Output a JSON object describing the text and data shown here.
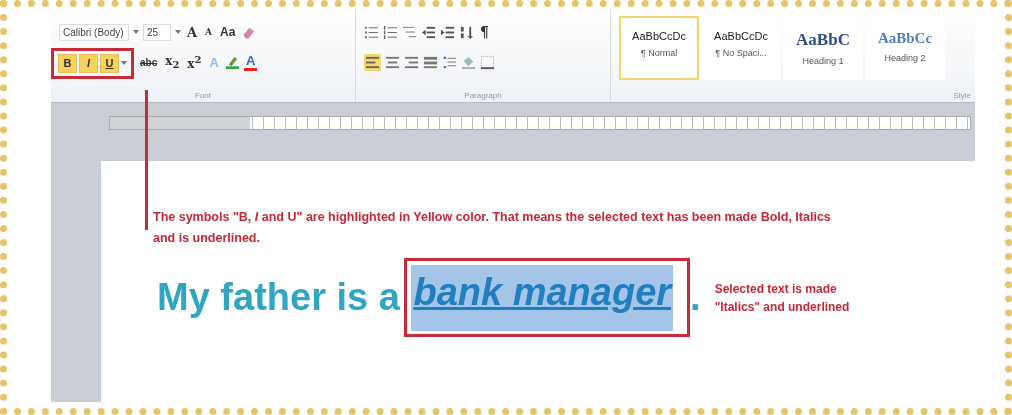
{
  "ribbon": {
    "font": {
      "font_name": "Calibri (Body)",
      "font_size": "25",
      "size_buttons": [
        "A",
        "A",
        "Aa"
      ],
      "format_buttons": [
        {
          "label": "B",
          "on": true
        },
        {
          "label": "I",
          "on": true
        },
        {
          "label": "U",
          "on": true
        }
      ],
      "script_buttons": [
        "abc",
        "x$_{2}$",
        "x$^{2}$"
      ],
      "color_buttons": [
        "A",
        "A"
      ],
      "group_label": "Font"
    },
    "paragraph": {
      "show_marks": "¶",
      "group_label": "Paragraph"
    },
    "styles": {
      "items": [
        {
          "preview": "AaBbCcDc",
          "name": "¶ Normal",
          "kind": "body",
          "selected": true
        },
        {
          "preview": "AaBbCcDc",
          "name": "¶ No Spaci...",
          "kind": "body",
          "selected": false
        },
        {
          "preview": "AaBbC",
          "name": "Heading 1",
          "kind": "heading1",
          "selected": false
        },
        {
          "preview": "AaBbCc",
          "name": "Heading 2",
          "kind": "heading2",
          "selected": false
        }
      ],
      "group_label": "Style"
    }
  },
  "annotations": [
    {
      "text": "The symbols \"B, *I* and U\" are highlighted in Yellow color. That means the selected text has been made Bold, Italics and is underlined."
    },
    {
      "text": "Selected text is made \"Italics\" and underlined"
    }
  ],
  "document": {
    "sentence": [
      {
        "text": "My father is a ",
        "selected": false
      },
      {
        "text": "bank manager",
        "selected": true
      },
      {
        "text": ".",
        "selected": false
      }
    ]
  }
}
